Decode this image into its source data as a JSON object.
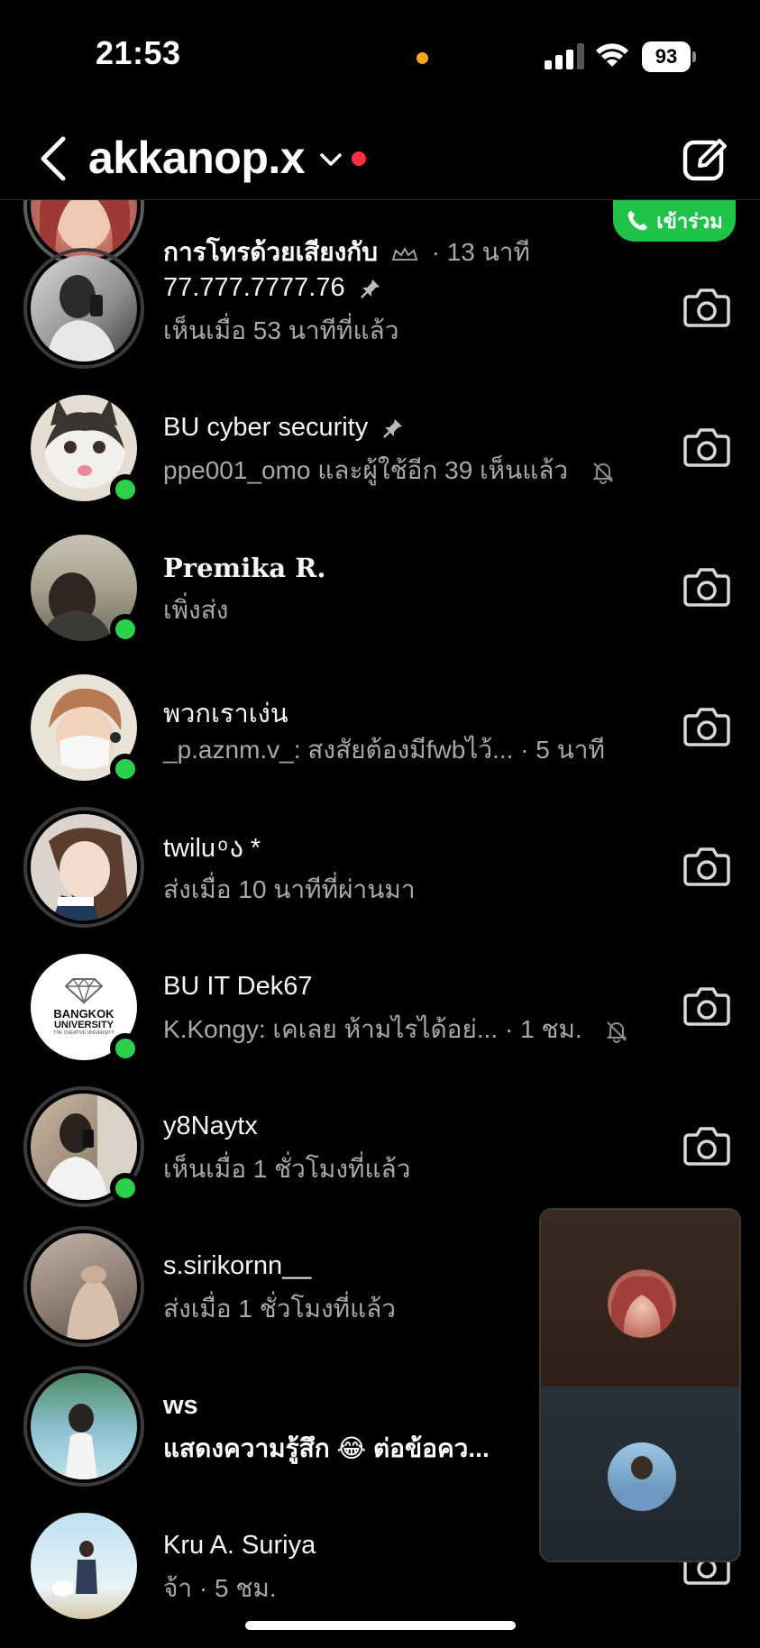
{
  "status_bar": {
    "time": "21:53",
    "battery": "93"
  },
  "header": {
    "account_name": "akkanop.x"
  },
  "call_row": {
    "subtitle": "การโทรด้วยเสียงกับ",
    "time": "· 13 นาที",
    "join_label": "เข้าร่วม"
  },
  "chats": [
    {
      "name": "77.777.7777.76",
      "sub": "เห็นเมื่อ 53 นาทีที่แล้ว"
    },
    {
      "name": "BU cyber security",
      "sub": "ppe001_omo และผู้ใช้อีก 39 เห็นแล้ว"
    },
    {
      "name": "Premika R.",
      "sub": "เพิ่งส่ง"
    },
    {
      "name": "พวกเราเง่น",
      "sub": "_p.aznm.v_: สงสัยต้องมีfwbไว้... · 5 นาที"
    },
    {
      "name": "twilu ͦ ა *",
      "sub": "ส่งเมื่อ 10 นาทีที่ผ่านมา"
    },
    {
      "name": "BU IT Dek67",
      "sub": "K.Kongy: เคเลย ห้ามไรได้อย่... · 1 ชม."
    },
    {
      "name": "y8Naytx",
      "sub": "เห็นเมื่อ 1 ชั่วโมงที่แล้ว"
    },
    {
      "name": "s.sirikornn__",
      "sub": "ส่งเมื่อ 1 ชั่วโมงที่แล้ว"
    },
    {
      "name": "ws",
      "sub": "แสดงความรู้สึก 😂 ต่อข้อคว..."
    },
    {
      "name": "Kru A. Suriya",
      "sub": "จ้า · 5 ชม."
    }
  ],
  "bu_logo": {
    "line1": "BANGKOK",
    "line2": "UNIVERSITY",
    "line3": "THE CREATIVE UNIVERSITY"
  },
  "colors": {
    "online": "#2bd14a",
    "join": "#1fc34a",
    "notification": "#ff3040",
    "status_dot": "#f5a623"
  },
  "icons": [
    "back-icon",
    "chevron-down-icon",
    "compose-icon",
    "camera-icon",
    "pin-icon",
    "mute-icon",
    "phone-icon",
    "crown-icon"
  ]
}
